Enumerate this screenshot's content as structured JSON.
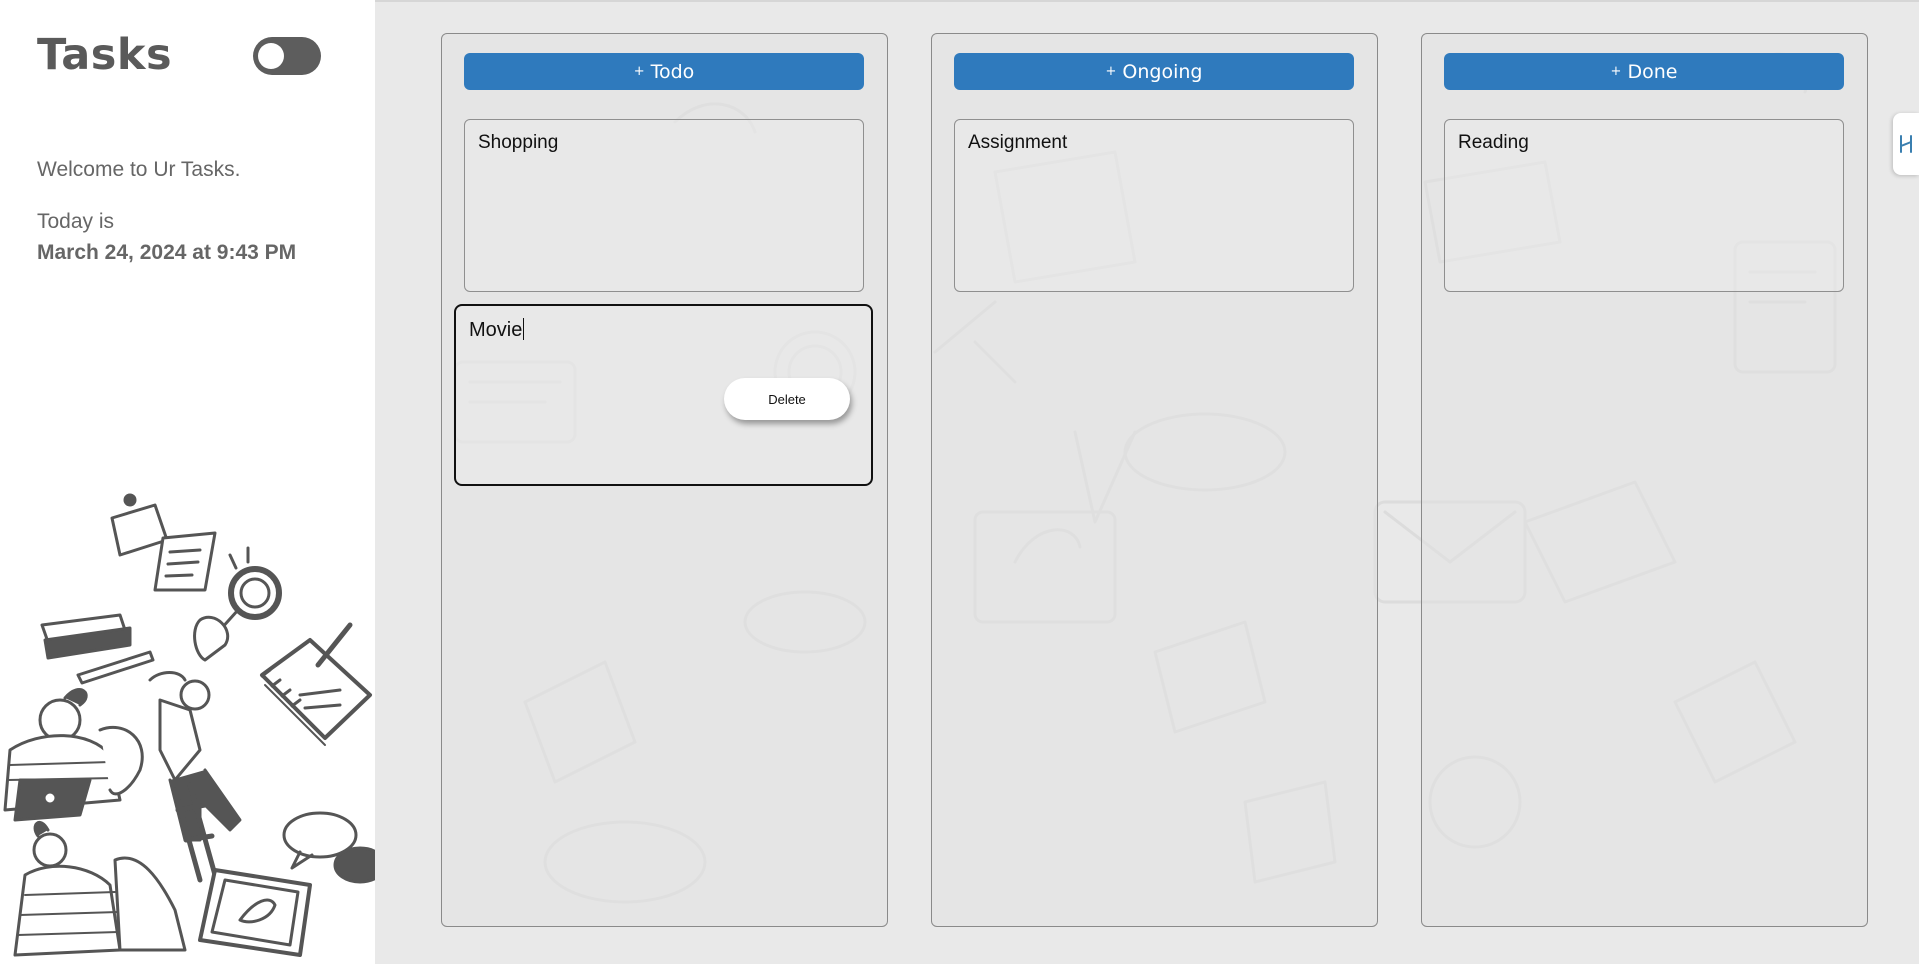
{
  "sidebar": {
    "title": "Tasks",
    "welcome": "Welcome to Ur Tasks.",
    "today_label": "Today is",
    "today_date": "March 24, 2024 at 9:43 PM",
    "theme_toggle_on": false
  },
  "columns": [
    {
      "button_label": "Todo",
      "cards": [
        "Shopping"
      ],
      "editing_card": {
        "text": "Movie",
        "delete_label": "Delete"
      }
    },
    {
      "button_label": "Ongoing",
      "cards": [
        "Assignment"
      ]
    },
    {
      "button_label": "Done",
      "cards": [
        "Reading"
      ]
    }
  ],
  "plus_symbol": "+",
  "colors": {
    "accent": "#2f7abd",
    "sidebar_bg": "#ffffff",
    "board_bg": "#e9e9e9",
    "title_text": "#5a5a5a",
    "toggle": "#5d5d5d"
  },
  "icons": [
    "toggle-switch",
    "side-panel-handle-icon"
  ]
}
